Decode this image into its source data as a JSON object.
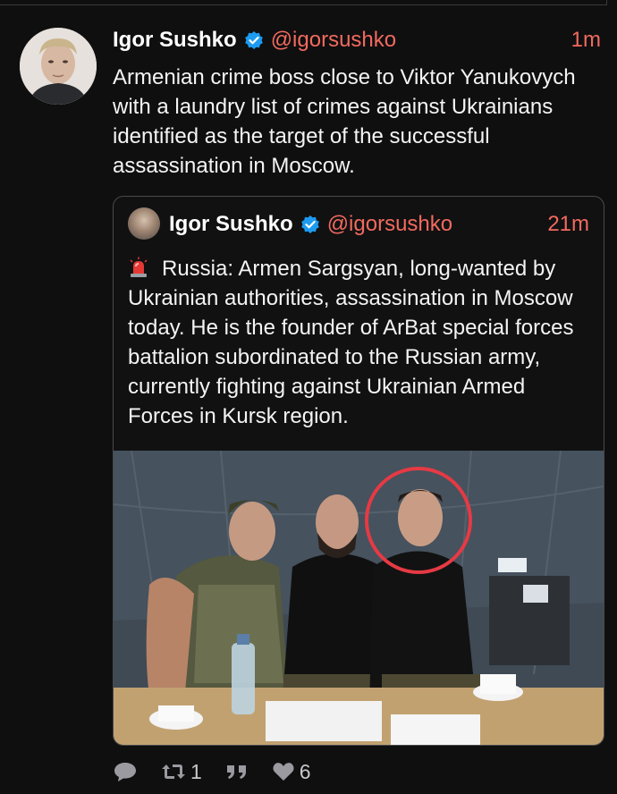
{
  "tweet": {
    "author_name": "Igor Sushko",
    "handle": "@igorsushko",
    "time": "1m",
    "text": "Armenian crime boss close to Viktor Yanukovych with a laundry list of crimes against Ukrainians identified as the target of the successful assassination in Moscow."
  },
  "quoted": {
    "author_name": "Igor Sushko",
    "handle": "@igorsushko",
    "time": "21m",
    "text": "Russia: Armen Sargsyan, long-wanted by Ukrainian authorities, assassination in Moscow today. He is the founder of ArBat special forces battalion subordinated to the Russian army, currently fighting against Ukrainian Armed Forces in Kursk region."
  },
  "actions": {
    "reply_icon": "reply-icon",
    "retweet_icon": "retweet-icon",
    "retweet_count": "1",
    "quote_icon": "quote-icon",
    "like_icon": "heart-icon",
    "like_count": "6"
  },
  "colors": {
    "accent": "#f26a5e",
    "verified": "#1d9bf0",
    "background": "#0f0f10",
    "highlight_circle": "#e53a44"
  }
}
